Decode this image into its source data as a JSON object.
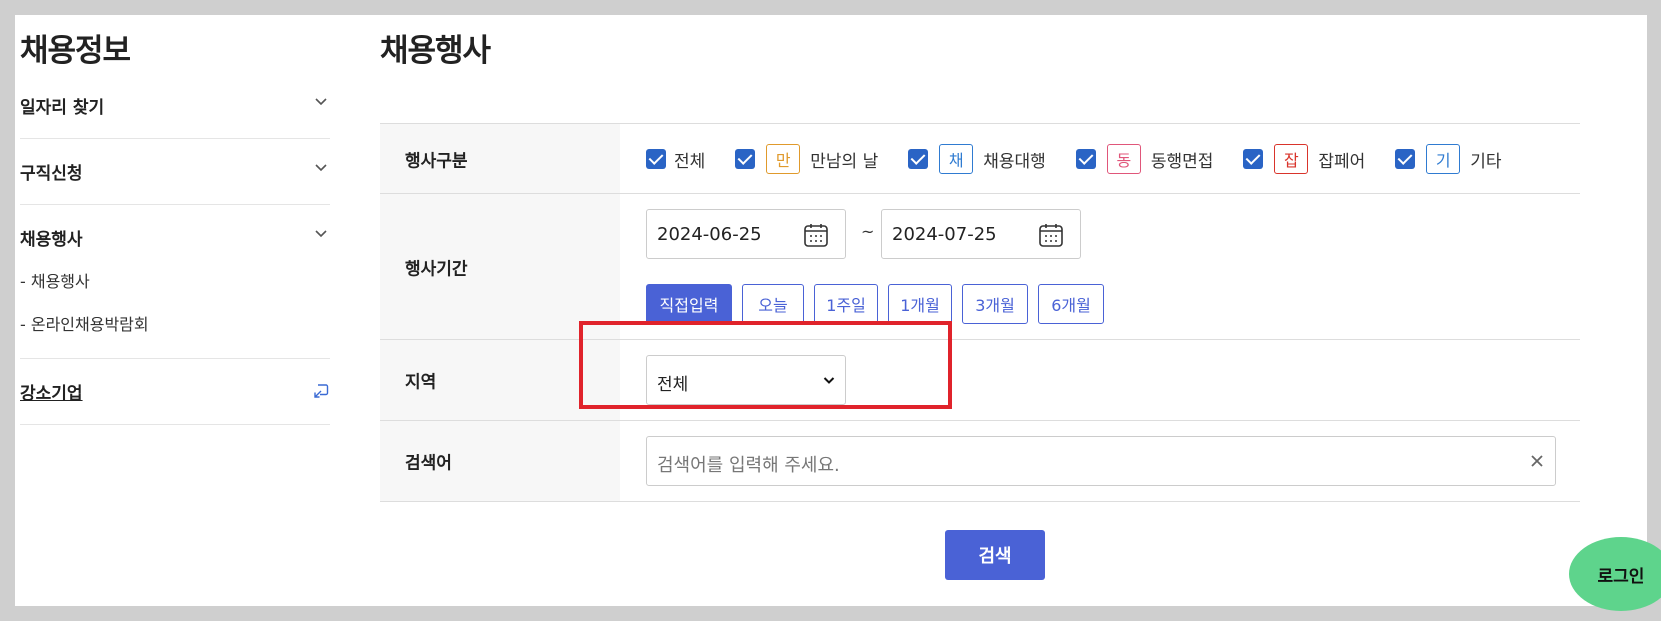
{
  "sidebar": {
    "title": "채용정보",
    "items": [
      {
        "label": "일자리 찾기"
      },
      {
        "label": "구직신청"
      },
      {
        "label": "채용행사",
        "sub": [
          "- 채용행사",
          "- 온라인채용박람회"
        ]
      },
      {
        "label": "강소기업"
      }
    ]
  },
  "main": {
    "title": "채용행사",
    "event_type": {
      "label": "행사구분",
      "options": [
        {
          "tag": "",
          "label": "전체",
          "checked": true
        },
        {
          "tag": "만",
          "label": "만남의 날",
          "color": "#e09a2c",
          "checked": true
        },
        {
          "tag": "채",
          "label": "채용대행",
          "color": "#2f7bd1",
          "checked": true
        },
        {
          "tag": "동",
          "label": "동행면접",
          "color": "#e0567a",
          "checked": true
        },
        {
          "tag": "잡",
          "label": "잡페어",
          "color": "#d9342b",
          "checked": true
        },
        {
          "tag": "기",
          "label": "기타",
          "color": "#2f7bd1",
          "checked": true
        }
      ]
    },
    "period": {
      "label": "행사기간",
      "start": "2024-06-25",
      "separator": "~",
      "end": "2024-07-25",
      "presets": [
        "직접입력",
        "오늘",
        "1주일",
        "1개월",
        "3개월",
        "6개월"
      ],
      "active_preset": "직접입력"
    },
    "region": {
      "label": "지역",
      "selected": "전체"
    },
    "keyword": {
      "label": "검색어",
      "placeholder": "검색어를 입력해 주세요."
    },
    "search_button": "검색"
  },
  "login_button": "로그인",
  "colors": {
    "accent": "#4a62d6",
    "highlight": "#e0232b",
    "login": "#5ed48c"
  }
}
